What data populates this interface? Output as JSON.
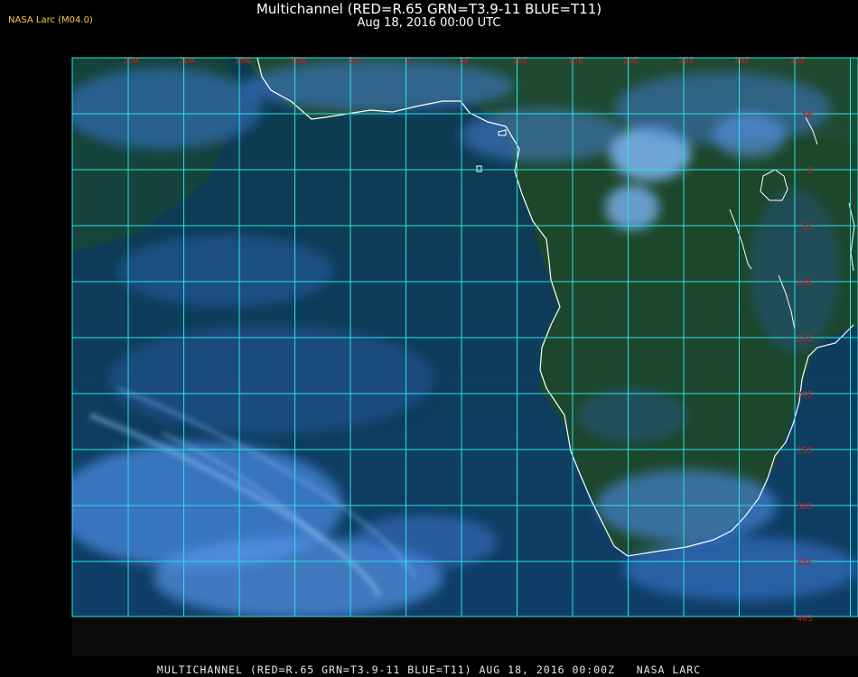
{
  "header": {
    "title": "Multichannel (RED=R.65 GRN=T3.9-11 BLUE=T11)",
    "subtitle": "Aug 18, 2016 00:00 UTC",
    "tag": "NASA Larc (M04.0)"
  },
  "longitude_labels": [
    "25W",
    "20W",
    "15W",
    "10W",
    "5W",
    "0",
    "5E",
    "10E",
    "15E",
    "20E",
    "25E",
    "30E",
    "35E"
  ],
  "latitude_labels": [
    "5N",
    "0",
    "5S",
    "10S",
    "15S",
    "20S",
    "25S",
    "30S",
    "35S",
    "40S"
  ],
  "footer": "MULTICHANNEL (RED=R.65 GRN=T3.9-11 BLUE=T11) AUG 18, 2016 00:00Z   NASA LARC",
  "colors": {
    "ocean": "#0c3a5a",
    "land": "#1f4a2a",
    "cloud": "#4a8fe0",
    "grid": "#22e6e6",
    "coast": "#ffffff",
    "label": "#d21b1b"
  }
}
